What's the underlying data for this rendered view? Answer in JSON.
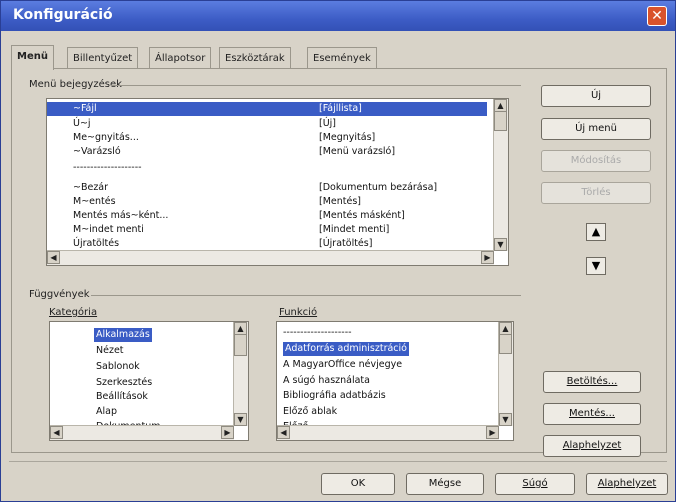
{
  "window": {
    "title": "Konfiguráció"
  },
  "tabs": [
    "Menü",
    "Billentyűzet",
    "Állapotsor",
    "Eszköztárak",
    "Események"
  ],
  "menu_section": {
    "group_label": "Menü bejegyzések",
    "entries": [
      {
        "name": "~Fájl",
        "cmd": "[Fájllista]"
      },
      {
        "name": "Ú~j",
        "cmd": "[Új]"
      },
      {
        "name": "Me~gnyitás...",
        "cmd": "[Megnyitás]"
      },
      {
        "name": "~Varázsló",
        "cmd": "[Menü varázsló]"
      },
      {
        "name": "--------------------",
        "cmd": ""
      },
      {
        "name": "~Bezár",
        "cmd": "[Dokumentum bezárása]"
      },
      {
        "name": "M~entés",
        "cmd": "[Mentés]"
      },
      {
        "name": "Mentés más~ként...",
        "cmd": "[Mentés másként]"
      },
      {
        "name": "M~indet menti",
        "cmd": "[Mindet menti]"
      },
      {
        "name": "Újratöltés",
        "cmd": "[Újratöltés]"
      }
    ],
    "buttons": {
      "new": "Új",
      "new_menu": "Új menü",
      "modify": "Módosítás",
      "delete": "Törlés"
    }
  },
  "functions_section": {
    "group_label": "Függvények",
    "category_label": "Kategória",
    "function_label": "Funkció",
    "categories": [
      "Alkalmazás",
      "Nézet",
      "Sablonok",
      "Szerkesztés",
      "Beállítások",
      "Alap",
      "Dokumentum"
    ],
    "functions": [
      "--------------------",
      "Adatforrás adminisztráció",
      "A MagyarOffice névjegye",
      "A súgó használata",
      "Bibliográfia adatbázis",
      "Előző ablak",
      "Előző"
    ],
    "buttons": {
      "load": "Betöltés...",
      "save": "Mentés...",
      "reset": "Alaphelyzet"
    }
  },
  "footer": {
    "ok": "OK",
    "cancel": "Mégse",
    "help": "Súgó",
    "reset": "Alaphelyzet"
  },
  "colors": {
    "titlebar": "#3d5dc6",
    "selection": "#3a5cc5",
    "dialog": "#d8d3c8"
  }
}
